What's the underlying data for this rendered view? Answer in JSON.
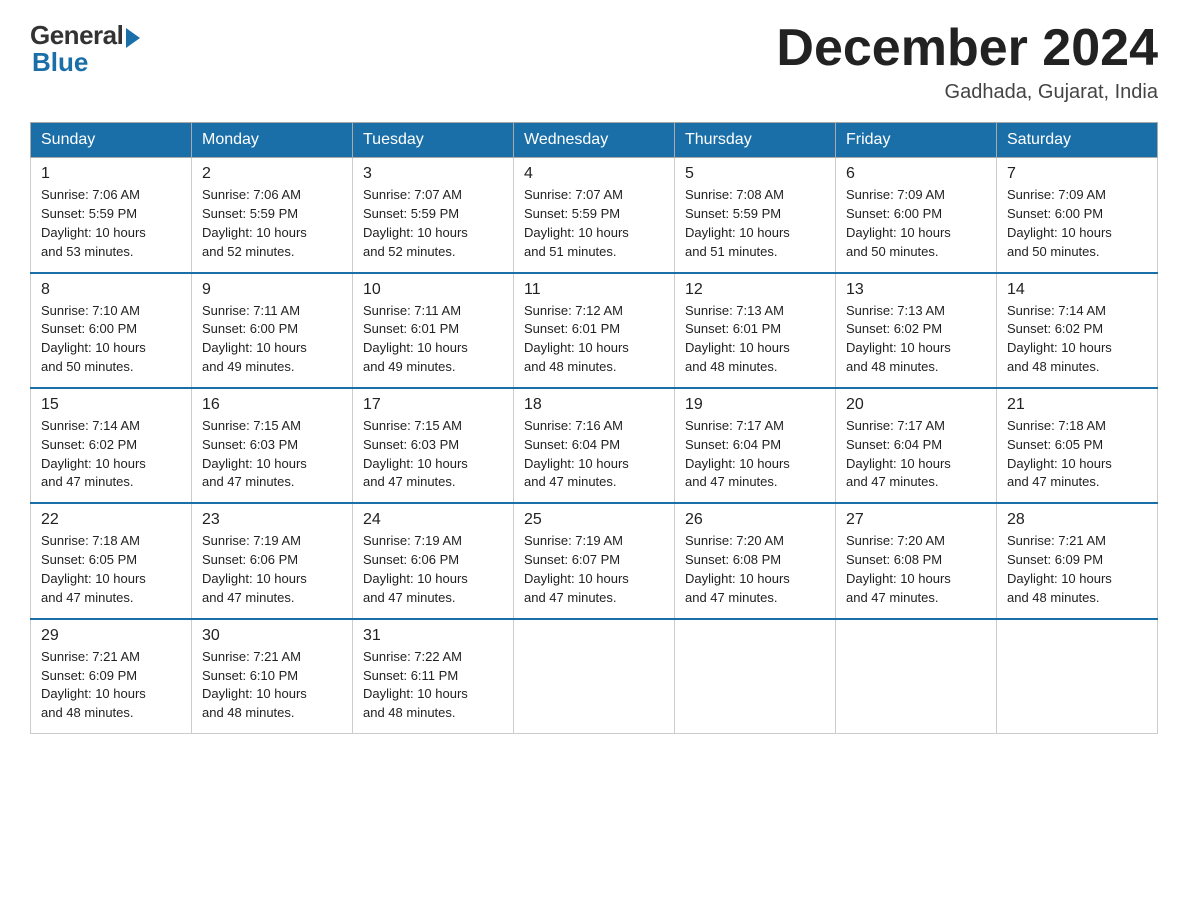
{
  "logo": {
    "general": "General",
    "blue": "Blue"
  },
  "title": "December 2024",
  "location": "Gadhada, Gujarat, India",
  "days_of_week": [
    "Sunday",
    "Monday",
    "Tuesday",
    "Wednesday",
    "Thursday",
    "Friday",
    "Saturday"
  ],
  "weeks": [
    [
      {
        "day": "1",
        "sunrise": "7:06 AM",
        "sunset": "5:59 PM",
        "daylight": "10 hours and 53 minutes."
      },
      {
        "day": "2",
        "sunrise": "7:06 AM",
        "sunset": "5:59 PM",
        "daylight": "10 hours and 52 minutes."
      },
      {
        "day": "3",
        "sunrise": "7:07 AM",
        "sunset": "5:59 PM",
        "daylight": "10 hours and 52 minutes."
      },
      {
        "day": "4",
        "sunrise": "7:07 AM",
        "sunset": "5:59 PM",
        "daylight": "10 hours and 51 minutes."
      },
      {
        "day": "5",
        "sunrise": "7:08 AM",
        "sunset": "5:59 PM",
        "daylight": "10 hours and 51 minutes."
      },
      {
        "day": "6",
        "sunrise": "7:09 AM",
        "sunset": "6:00 PM",
        "daylight": "10 hours and 50 minutes."
      },
      {
        "day": "7",
        "sunrise": "7:09 AM",
        "sunset": "6:00 PM",
        "daylight": "10 hours and 50 minutes."
      }
    ],
    [
      {
        "day": "8",
        "sunrise": "7:10 AM",
        "sunset": "6:00 PM",
        "daylight": "10 hours and 50 minutes."
      },
      {
        "day": "9",
        "sunrise": "7:11 AM",
        "sunset": "6:00 PM",
        "daylight": "10 hours and 49 minutes."
      },
      {
        "day": "10",
        "sunrise": "7:11 AM",
        "sunset": "6:01 PM",
        "daylight": "10 hours and 49 minutes."
      },
      {
        "day": "11",
        "sunrise": "7:12 AM",
        "sunset": "6:01 PM",
        "daylight": "10 hours and 48 minutes."
      },
      {
        "day": "12",
        "sunrise": "7:13 AM",
        "sunset": "6:01 PM",
        "daylight": "10 hours and 48 minutes."
      },
      {
        "day": "13",
        "sunrise": "7:13 AM",
        "sunset": "6:02 PM",
        "daylight": "10 hours and 48 minutes."
      },
      {
        "day": "14",
        "sunrise": "7:14 AM",
        "sunset": "6:02 PM",
        "daylight": "10 hours and 48 minutes."
      }
    ],
    [
      {
        "day": "15",
        "sunrise": "7:14 AM",
        "sunset": "6:02 PM",
        "daylight": "10 hours and 47 minutes."
      },
      {
        "day": "16",
        "sunrise": "7:15 AM",
        "sunset": "6:03 PM",
        "daylight": "10 hours and 47 minutes."
      },
      {
        "day": "17",
        "sunrise": "7:15 AM",
        "sunset": "6:03 PM",
        "daylight": "10 hours and 47 minutes."
      },
      {
        "day": "18",
        "sunrise": "7:16 AM",
        "sunset": "6:04 PM",
        "daylight": "10 hours and 47 minutes."
      },
      {
        "day": "19",
        "sunrise": "7:17 AM",
        "sunset": "6:04 PM",
        "daylight": "10 hours and 47 minutes."
      },
      {
        "day": "20",
        "sunrise": "7:17 AM",
        "sunset": "6:04 PM",
        "daylight": "10 hours and 47 minutes."
      },
      {
        "day": "21",
        "sunrise": "7:18 AM",
        "sunset": "6:05 PM",
        "daylight": "10 hours and 47 minutes."
      }
    ],
    [
      {
        "day": "22",
        "sunrise": "7:18 AM",
        "sunset": "6:05 PM",
        "daylight": "10 hours and 47 minutes."
      },
      {
        "day": "23",
        "sunrise": "7:19 AM",
        "sunset": "6:06 PM",
        "daylight": "10 hours and 47 minutes."
      },
      {
        "day": "24",
        "sunrise": "7:19 AM",
        "sunset": "6:06 PM",
        "daylight": "10 hours and 47 minutes."
      },
      {
        "day": "25",
        "sunrise": "7:19 AM",
        "sunset": "6:07 PM",
        "daylight": "10 hours and 47 minutes."
      },
      {
        "day": "26",
        "sunrise": "7:20 AM",
        "sunset": "6:08 PM",
        "daylight": "10 hours and 47 minutes."
      },
      {
        "day": "27",
        "sunrise": "7:20 AM",
        "sunset": "6:08 PM",
        "daylight": "10 hours and 47 minutes."
      },
      {
        "day": "28",
        "sunrise": "7:21 AM",
        "sunset": "6:09 PM",
        "daylight": "10 hours and 48 minutes."
      }
    ],
    [
      {
        "day": "29",
        "sunrise": "7:21 AM",
        "sunset": "6:09 PM",
        "daylight": "10 hours and 48 minutes."
      },
      {
        "day": "30",
        "sunrise": "7:21 AM",
        "sunset": "6:10 PM",
        "daylight": "10 hours and 48 minutes."
      },
      {
        "day": "31",
        "sunrise": "7:22 AM",
        "sunset": "6:11 PM",
        "daylight": "10 hours and 48 minutes."
      },
      null,
      null,
      null,
      null
    ]
  ],
  "labels": {
    "sunrise": "Sunrise:",
    "sunset": "Sunset:",
    "daylight": "Daylight:"
  }
}
